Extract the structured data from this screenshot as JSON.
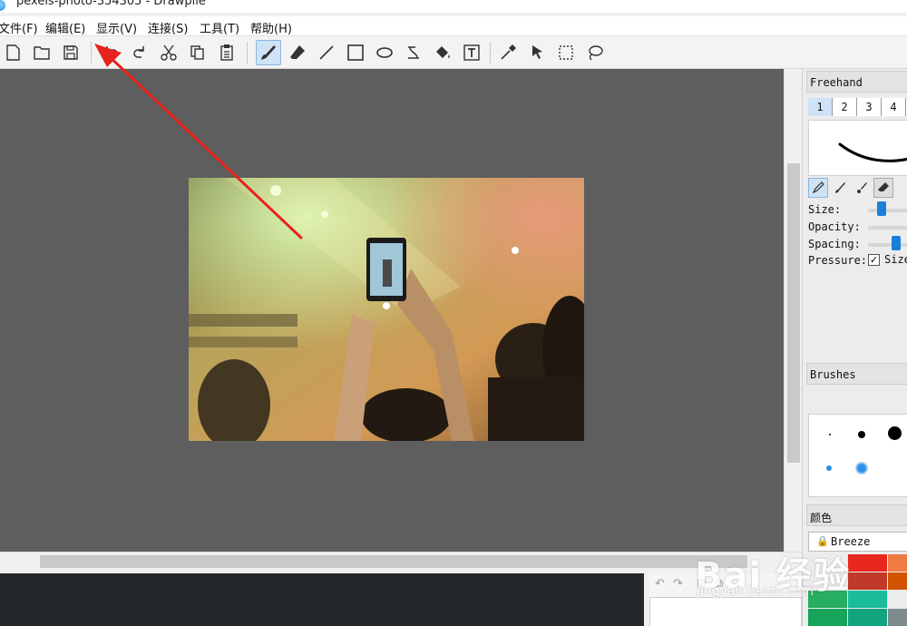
{
  "window": {
    "title": "pexels-photo-354305 - Drawpile"
  },
  "menu": [
    "文件(F)",
    "编辑(E)",
    "显示(V)",
    "连接(S)",
    "工具(T)",
    "帮助(H)"
  ],
  "toolbar": {
    "file_tools": [
      "new-icon",
      "open-icon",
      "save-icon"
    ],
    "edit_tools": [
      "undo-icon",
      "redo-icon",
      "cut-icon",
      "copy-icon",
      "paste-icon"
    ],
    "draw_tools": [
      "freehand-brush-icon",
      "eraser-icon",
      "line-icon",
      "rectangle-icon",
      "ellipse-icon",
      "bezier-icon",
      "fill-bucket-icon",
      "text-icon"
    ],
    "select_tools": [
      "color-picker-icon",
      "laser-pointer-icon",
      "rect-select-icon",
      "lasso-select-icon"
    ],
    "active_tool": "freehand-brush-icon"
  },
  "dock": {
    "tool_settings": {
      "title": "Freehand",
      "brush_tabs": [
        "1",
        "2",
        "3",
        "4"
      ],
      "selected_tab": "1",
      "labels": {
        "size": "Size:",
        "opacity": "Opacity:",
        "spacing": "Spacing:",
        "pressure": "Pressure:",
        "pressure_size": "Size"
      },
      "pressure_size_checked": true
    },
    "brushes": {
      "title": "Brushes"
    },
    "color": {
      "title": "颜色",
      "palette": "Breeze",
      "swatches": [
        "#e8281f",
        "#f07b42",
        "#c0392b",
        "#d35400",
        "#27ae60",
        "#1abc9c",
        "#16a35a",
        "#12a37f",
        "#2c3e50",
        "#7f8c8d"
      ]
    }
  },
  "watermark": {
    "text": "Bai 经验",
    "url": "jingyan.baidu.com"
  },
  "colors": {
    "canvas_bg": "#5e5e5e",
    "annotation_arrow": "#e8231b",
    "accent": "#1a7fd8"
  }
}
